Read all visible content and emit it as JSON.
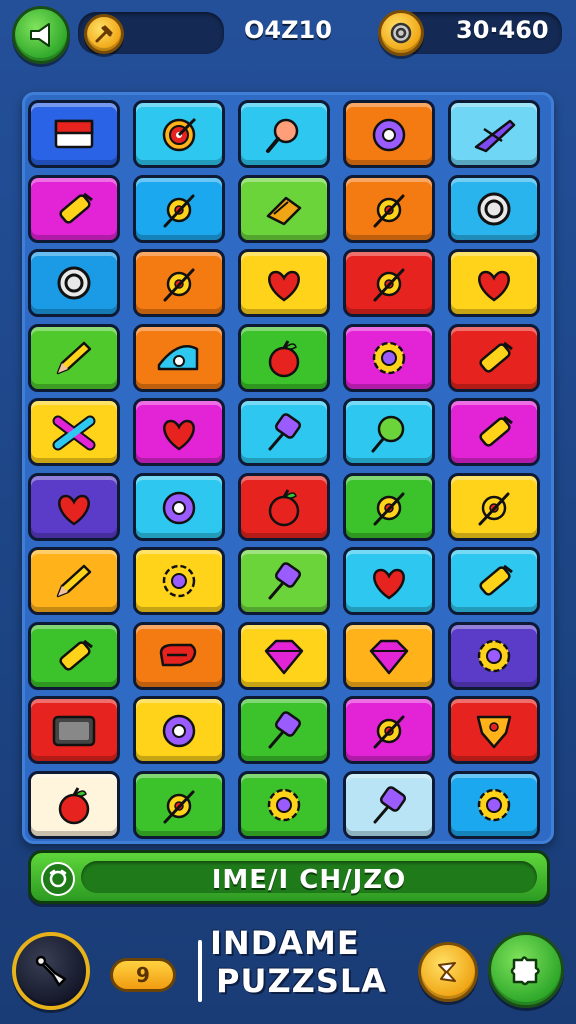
{
  "hud": {
    "back_icon": "megaphone-icon",
    "moves_icon": "hammer-icon",
    "score": "O4Z10",
    "coin_icon": "coin-icon",
    "coins": "30·460"
  },
  "board": {
    "rows": [
      [
        {
          "color": "#2a63e6",
          "icon": "flag-icon"
        },
        {
          "color": "#2ec7f0",
          "icon": "target-icon"
        },
        {
          "color": "#2ec7f0",
          "icon": "magnifier-icon"
        },
        {
          "color": "#f47a12",
          "icon": "donut-icon"
        },
        {
          "color": "#6fd6f5",
          "icon": "airplane-icon"
        }
      ],
      [
        {
          "color": "#e223d6",
          "icon": "crayon-icon"
        },
        {
          "color": "#1ba8ee",
          "icon": "ring-wand-icon"
        },
        {
          "color": "#6bd43a",
          "icon": "sandwich-icon"
        },
        {
          "color": "#f47a12",
          "icon": "ring-wand-icon"
        },
        {
          "color": "#2ab4ee",
          "icon": "ring-icon"
        }
      ],
      [
        {
          "color": "#1b9be6",
          "icon": "ring-icon"
        },
        {
          "color": "#f47a12",
          "icon": "ring-wand-icon"
        },
        {
          "color": "#ffd31a",
          "icon": "heart-icon"
        },
        {
          "color": "#e6231e",
          "icon": "ring-wand-icon"
        },
        {
          "color": "#ffd31a",
          "icon": "heart-icon"
        }
      ],
      [
        {
          "color": "#4fc92c",
          "icon": "pencil-icon"
        },
        {
          "color": "#f47a12",
          "icon": "eye-icon"
        },
        {
          "color": "#3cc22a",
          "icon": "apple-icon"
        },
        {
          "color": "#e223d6",
          "icon": "gear-icon"
        },
        {
          "color": "#e6231e",
          "icon": "crayon-icon"
        }
      ],
      [
        {
          "color": "#ffd31a",
          "icon": "cross-icon"
        },
        {
          "color": "#e223d6",
          "icon": "heart-icon"
        },
        {
          "color": "#2ec7f0",
          "icon": "popsicle-icon"
        },
        {
          "color": "#2ec7f0",
          "icon": "lollipop-icon"
        },
        {
          "color": "#e223d6",
          "icon": "crayon-icon"
        }
      ],
      [
        {
          "color": "#5a3cc8",
          "icon": "heart-icon"
        },
        {
          "color": "#2ec7f0",
          "icon": "donut-icon"
        },
        {
          "color": "#e6231e",
          "icon": "apple-icon"
        },
        {
          "color": "#3cc22a",
          "icon": "ring-wand-icon"
        },
        {
          "color": "#ffd31a",
          "icon": "ring-wand-icon"
        }
      ],
      [
        {
          "color": "#ffb21a",
          "icon": "pencil-icon"
        },
        {
          "color": "#ffd31a",
          "icon": "gear-icon"
        },
        {
          "color": "#6bd43a",
          "icon": "popsicle-icon"
        },
        {
          "color": "#2ec7f0",
          "icon": "heart-icon"
        },
        {
          "color": "#2ec7f0",
          "icon": "crayon-icon"
        }
      ],
      [
        {
          "color": "#3cc22a",
          "icon": "crayon-icon"
        },
        {
          "color": "#f47a12",
          "icon": "knot-icon"
        },
        {
          "color": "#ffd31a",
          "icon": "gem-icon"
        },
        {
          "color": "#ffb21a",
          "icon": "gem-icon"
        },
        {
          "color": "#5a3cc8",
          "icon": "gear-icon"
        }
      ],
      [
        {
          "color": "#e6231e",
          "icon": "tv-icon"
        },
        {
          "color": "#ffd31a",
          "icon": "donut-icon"
        },
        {
          "color": "#3cc22a",
          "icon": "popsicle-icon"
        },
        {
          "color": "#e223d6",
          "icon": "ring-wand-icon"
        },
        {
          "color": "#e6231e",
          "icon": "shield-icon"
        }
      ],
      [
        {
          "color": "#fff5dc",
          "icon": "apple-icon"
        },
        {
          "color": "#3cc22a",
          "icon": "ring-wand-icon"
        },
        {
          "color": "#3cc22a",
          "icon": "gear-icon"
        },
        {
          "color": "#b8e4f5",
          "icon": "popsicle-icon"
        },
        {
          "color": "#1ba8ee",
          "icon": "gear-icon"
        }
      ]
    ]
  },
  "status": {
    "icon": "clock-icon",
    "text": "IME/I CH/JZO"
  },
  "footer": {
    "left_icon": "tool-icon",
    "counter": "9",
    "title_line1": "INDAME",
    "title_line2": "PUZZSLA",
    "hint_icon": "star-icon",
    "play_icon": "puzzle-icon"
  }
}
